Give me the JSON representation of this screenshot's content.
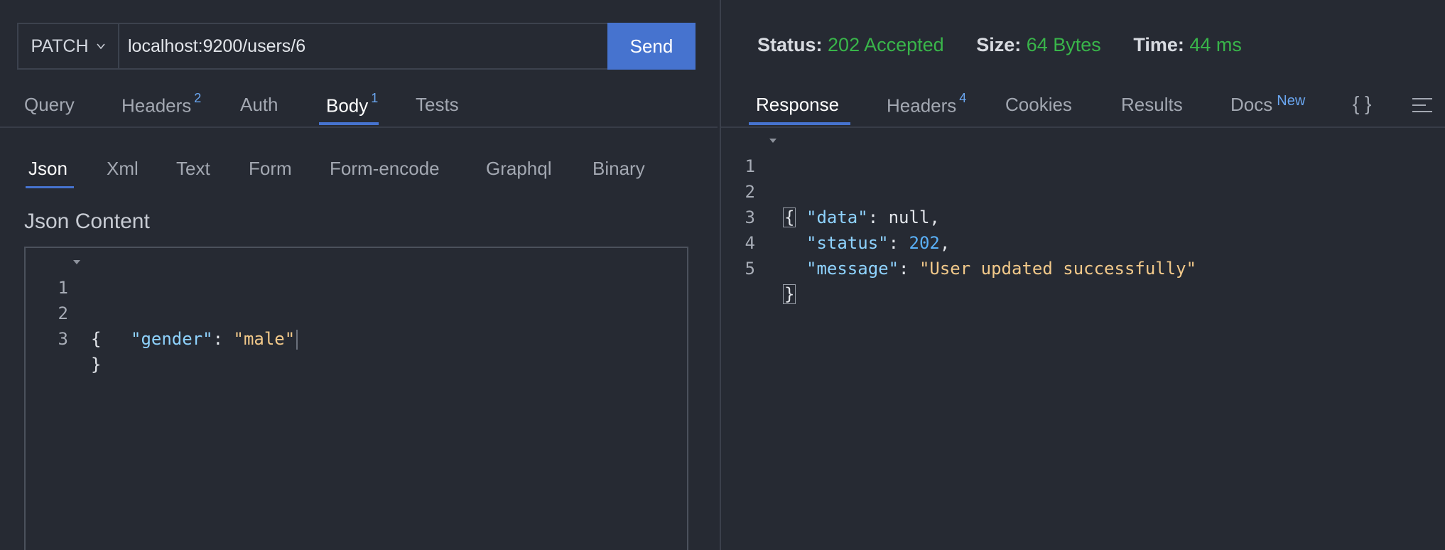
{
  "request": {
    "method": "PATCH",
    "url": "localhost:9200/users/6",
    "send_label": "Send",
    "tabs": [
      {
        "label": "Query",
        "badge": ""
      },
      {
        "label": "Headers",
        "badge": "2"
      },
      {
        "label": "Auth",
        "badge": ""
      },
      {
        "label": "Body",
        "badge": "1"
      },
      {
        "label": "Tests",
        "badge": ""
      }
    ],
    "active_tab": "Body",
    "body_tabs": [
      "Json",
      "Xml",
      "Text",
      "Form",
      "Form-encode",
      "Graphql",
      "Binary"
    ],
    "active_body_tab": "Json",
    "json_content_label": "Json Content",
    "editor_lines": [
      {
        "n": "1",
        "text": "{"
      },
      {
        "n": "2",
        "key": "\"gender\"",
        "sep": ": ",
        "value": "\"male\""
      },
      {
        "n": "3",
        "text": "}"
      }
    ]
  },
  "response": {
    "status_label": "Status:",
    "status_value": "202 Accepted",
    "size_label": "Size:",
    "size_value": "64 Bytes",
    "time_label": "Time:",
    "time_value": "44 ms",
    "status_color": "#39b54a",
    "tabs": [
      {
        "label": "Response",
        "badge": ""
      },
      {
        "label": "Headers",
        "badge": "4"
      },
      {
        "label": "Cookies",
        "badge": ""
      },
      {
        "label": "Results",
        "badge": ""
      },
      {
        "label": "Docs",
        "badge": "New"
      }
    ],
    "active_tab": "Response",
    "braces_icon_text": "{ }",
    "icons": [
      "braces-icon",
      "menu-lines-icon"
    ],
    "lines": [
      {
        "n": "1",
        "text": "{"
      },
      {
        "n": "2",
        "key": "\"data\"",
        "sep": ": ",
        "value": "null",
        "trail": ","
      },
      {
        "n": "3",
        "key": "\"status\"",
        "sep": ": ",
        "value": "202",
        "trail": ","
      },
      {
        "n": "4",
        "key": "\"message\"",
        "sep": ": ",
        "value": "\"User updated successfully\"",
        "trail": ""
      },
      {
        "n": "5",
        "text": "}"
      }
    ]
  },
  "colors": {
    "background": "#262a33",
    "accent": "#4673cf",
    "json_key": "#8fd3ff",
    "json_string": "#f2c98a",
    "json_number": "#5ab0f7"
  }
}
